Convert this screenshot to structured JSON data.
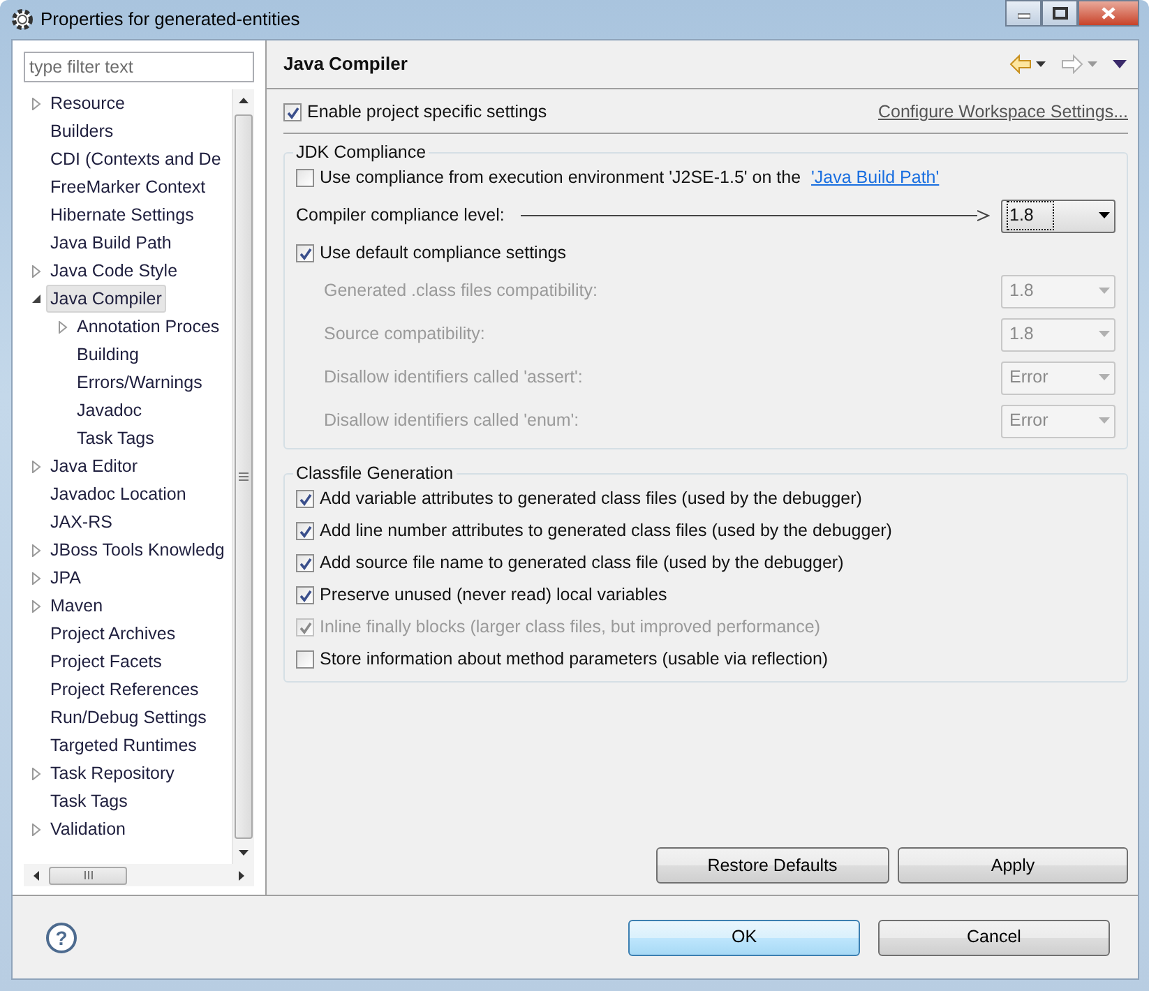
{
  "window": {
    "title": "Properties for generated-entities"
  },
  "filter": {
    "placeholder": "type filter text"
  },
  "tree": [
    {
      "label": "Resource",
      "expandable": true,
      "expanded": false,
      "selected": false
    },
    {
      "label": "Builders",
      "expandable": false,
      "selected": false
    },
    {
      "label": "CDI (Contexts and De",
      "expandable": false,
      "selected": false
    },
    {
      "label": "FreeMarker Context",
      "expandable": false,
      "selected": false
    },
    {
      "label": "Hibernate Settings",
      "expandable": false,
      "selected": false
    },
    {
      "label": "Java Build Path",
      "expandable": false,
      "selected": false
    },
    {
      "label": "Java Code Style",
      "expandable": true,
      "expanded": false,
      "selected": false
    },
    {
      "label": "Java Compiler",
      "expandable": true,
      "expanded": true,
      "selected": true,
      "children": [
        {
          "label": "Annotation Proces",
          "expandable": true,
          "expanded": false,
          "selected": false
        },
        {
          "label": "Building",
          "expandable": false,
          "selected": false
        },
        {
          "label": "Errors/Warnings",
          "expandable": false,
          "selected": false
        },
        {
          "label": "Javadoc",
          "expandable": false,
          "selected": false
        },
        {
          "label": "Task Tags",
          "expandable": false,
          "selected": false
        }
      ]
    },
    {
      "label": "Java Editor",
      "expandable": true,
      "expanded": false,
      "selected": false
    },
    {
      "label": "Javadoc Location",
      "expandable": false,
      "selected": false
    },
    {
      "label": "JAX-RS",
      "expandable": false,
      "selected": false
    },
    {
      "label": "JBoss Tools Knowledg",
      "expandable": true,
      "expanded": false,
      "selected": false
    },
    {
      "label": "JPA",
      "expandable": true,
      "expanded": false,
      "selected": false
    },
    {
      "label": "Maven",
      "expandable": true,
      "expanded": false,
      "selected": false
    },
    {
      "label": "Project Archives",
      "expandable": false,
      "selected": false
    },
    {
      "label": "Project Facets",
      "expandable": false,
      "selected": false
    },
    {
      "label": "Project References",
      "expandable": false,
      "selected": false
    },
    {
      "label": "Run/Debug Settings",
      "expandable": false,
      "selected": false
    },
    {
      "label": "Targeted Runtimes",
      "expandable": false,
      "selected": false
    },
    {
      "label": "Task Repository",
      "expandable": true,
      "expanded": false,
      "selected": false
    },
    {
      "label": "Task Tags",
      "expandable": false,
      "selected": false
    },
    {
      "label": "Validation",
      "expandable": true,
      "expanded": false,
      "selected": false
    }
  ],
  "page": {
    "title": "Java Compiler",
    "enable_project": {
      "label": "Enable project specific settings",
      "checked": true
    },
    "configure_link": "Configure Workspace Settings...",
    "jdk_group": {
      "title": "JDK Compliance",
      "use_ee": {
        "label": "Use compliance from execution environment 'J2SE-1.5' on the ",
        "link": "'Java Build Path'",
        "checked": false
      },
      "compliance": {
        "label": "Compiler compliance level:",
        "value": "1.8"
      },
      "use_default": {
        "label": "Use default compliance settings",
        "checked": true
      },
      "settings": [
        {
          "label": "Generated .class files compatibility:",
          "value": "1.8",
          "disabled": true
        },
        {
          "label": "Source compatibility:",
          "value": "1.8",
          "disabled": true
        },
        {
          "label": "Disallow identifiers called 'assert':",
          "value": "Error",
          "disabled": true
        },
        {
          "label": "Disallow identifiers called 'enum':",
          "value": "Error",
          "disabled": true
        }
      ]
    },
    "classfile_group": {
      "title": "Classfile Generation",
      "options": [
        {
          "label": "Add variable attributes to generated class files (used by the debugger)",
          "checked": true,
          "disabled": false
        },
        {
          "label": "Add line number attributes to generated class files (used by the debugger)",
          "checked": true,
          "disabled": false
        },
        {
          "label": "Add source file name to generated class file (used by the debugger)",
          "checked": true,
          "disabled": false
        },
        {
          "label": "Preserve unused (never read) local variables",
          "checked": true,
          "disabled": false
        },
        {
          "label": "Inline finally blocks (larger class files, but improved performance)",
          "checked": true,
          "disabled": true
        },
        {
          "label": "Store information about method parameters (usable via reflection)",
          "checked": false,
          "disabled": false
        }
      ]
    },
    "restore_button": "Restore Defaults",
    "apply_button": "Apply"
  },
  "help": "?",
  "ok_button": "OK",
  "cancel_button": "Cancel"
}
